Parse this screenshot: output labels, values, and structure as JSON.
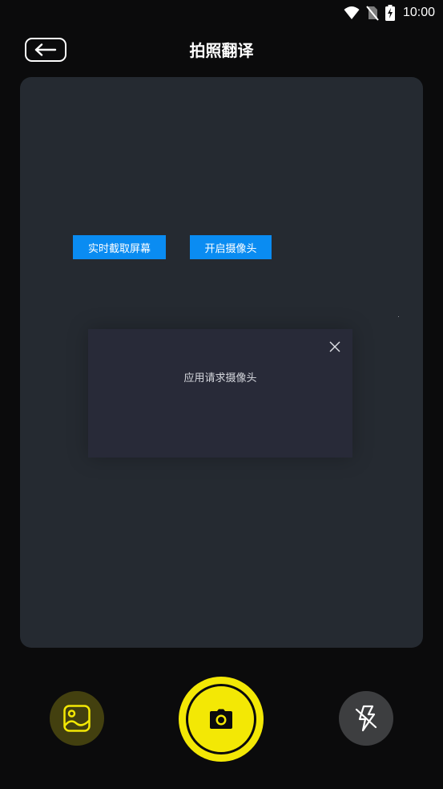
{
  "status_bar": {
    "time": "10:00"
  },
  "header": {
    "title": "拍照翻译",
    "back_icon": "arrow-left-icon"
  },
  "dialog": {
    "message": "应用请求摄像头",
    "close_icon": "close-icon",
    "buttons": {
      "screen_capture": "实时截取屏幕",
      "open_camera": "开启摄像头"
    }
  },
  "controls": {
    "gallery_icon": "image-icon",
    "shutter_icon": "camera-icon",
    "flash_icon": "flash-off-icon"
  },
  "colors": {
    "background": "#0b0b0c",
    "preview": "#252a31",
    "dialog": "#282a38",
    "dialog_button": "#0a8cf2",
    "accent_yellow": "#f3e805",
    "gallery_bg": "#43400f",
    "flash_bg": "#3d3e40"
  }
}
